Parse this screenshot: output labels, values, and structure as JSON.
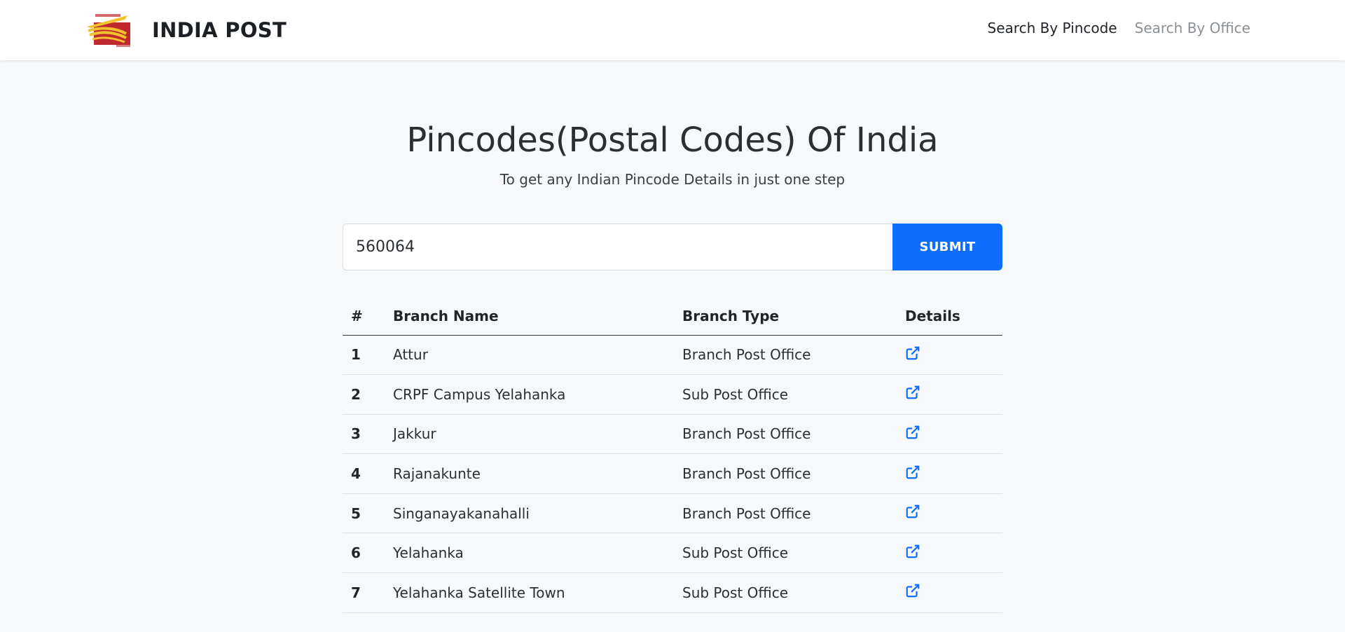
{
  "header": {
    "brand": "INDIA POST",
    "logo_icon": "india-post-logo",
    "nav": [
      {
        "label": "Search By Pincode",
        "active": true
      },
      {
        "label": "Search By Office",
        "active": false
      }
    ]
  },
  "hero": {
    "title": "Pincodes(Postal Codes) Of India",
    "subtitle": "To get any Indian Pincode Details in just one step"
  },
  "search": {
    "value": "560064",
    "submit_label": "SUBMIT"
  },
  "table": {
    "headers": [
      "#",
      "Branch Name",
      "Branch Type",
      "Details"
    ],
    "rows": [
      {
        "num": "1",
        "name": "Attur",
        "type": "Branch Post Office",
        "icon": "external-link-icon"
      },
      {
        "num": "2",
        "name": "CRPF Campus Yelahanka",
        "type": "Sub Post Office",
        "icon": "external-link-icon"
      },
      {
        "num": "3",
        "name": "Jakkur",
        "type": "Branch Post Office",
        "icon": "external-link-icon"
      },
      {
        "num": "4",
        "name": "Rajanakunte",
        "type": "Branch Post Office",
        "icon": "external-link-icon"
      },
      {
        "num": "5",
        "name": "Singanayakanahalli",
        "type": "Branch Post Office",
        "icon": "external-link-icon"
      },
      {
        "num": "6",
        "name": "Yelahanka",
        "type": "Sub Post Office",
        "icon": "external-link-icon"
      },
      {
        "num": "7",
        "name": "Yelahanka Satellite Town",
        "type": "Sub Post Office",
        "icon": "external-link-icon"
      }
    ]
  },
  "colors": {
    "accent": "#0d6efd",
    "background": "#f7f8fa",
    "logo_red": "#c0282d",
    "logo_yellow": "#f2c12e"
  }
}
